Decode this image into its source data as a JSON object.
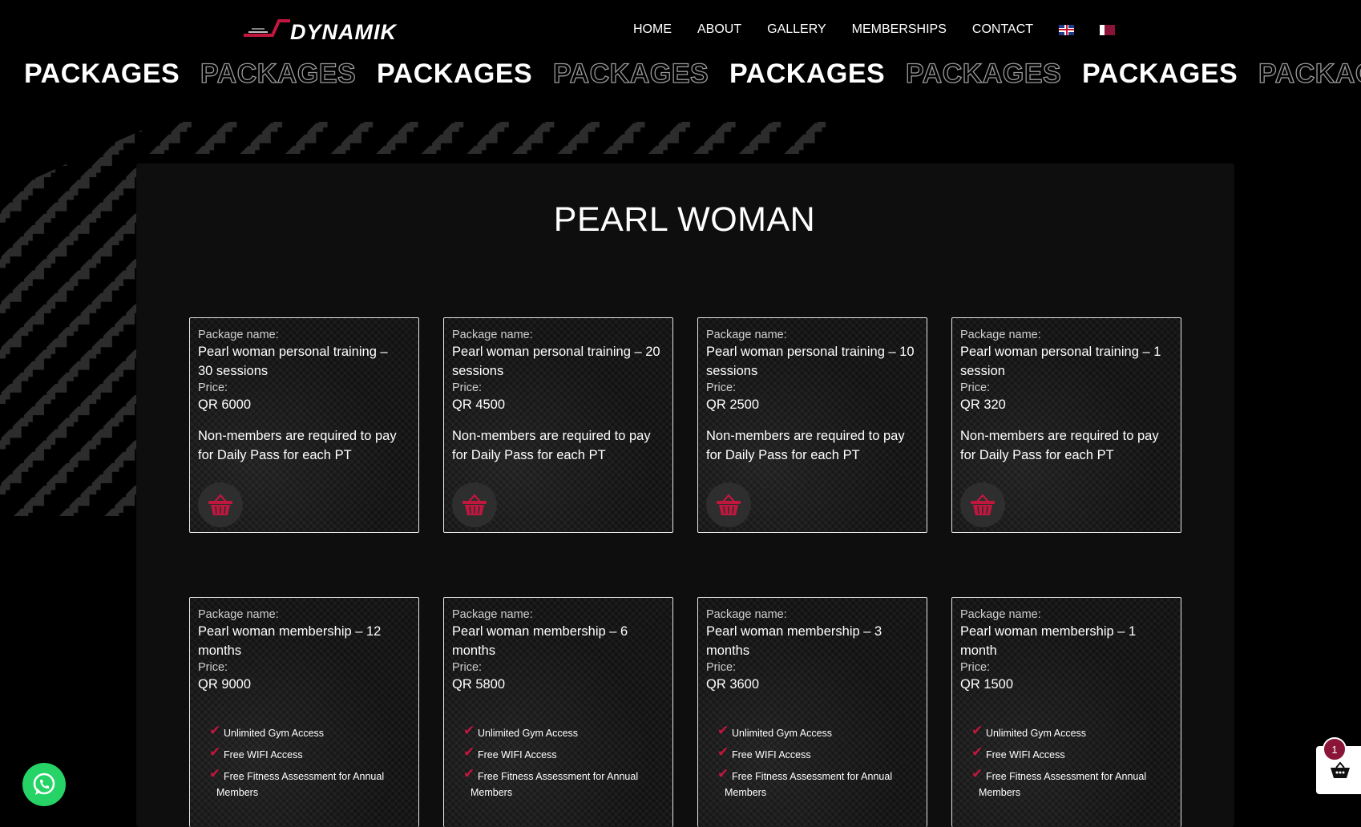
{
  "header": {
    "logo_text": "DYNAMIK",
    "nav": [
      {
        "label": "HOME"
      },
      {
        "label": "ABOUT"
      },
      {
        "label": "GALLERY"
      },
      {
        "label": "MEMBERSHIPS"
      },
      {
        "label": "CONTACT"
      }
    ],
    "flags": [
      "uk-flag-icon",
      "qatar-flag-icon"
    ]
  },
  "marquee": {
    "words": [
      "PACKAGES",
      "PACKAGES",
      "PACKAGES",
      "PACKAGES",
      "PACKAGES",
      "PACKAGES",
      "PACKAGES",
      "PACKAGES"
    ]
  },
  "section": {
    "title": "PEARL WOMAN"
  },
  "labels": {
    "package_name": "Package name:",
    "price": "Price:"
  },
  "pt_packages": [
    {
      "name_line1": "Pearl woman personal training –",
      "name_line2": "30 sessions",
      "price": "QR 6000",
      "note_line1": "Non-members are required to pay",
      "note_line2": "for Daily Pass for each PT"
    },
    {
      "name_line1": "Pearl woman personal training – 20",
      "name_line2": "sessions",
      "price": "QR 4500",
      "note_line1": "Non-members are required to pay",
      "note_line2": "for Daily Pass for each PT"
    },
    {
      "name_line1": "Pearl woman personal training – 10",
      "name_line2": "sessions",
      "price": "QR 2500",
      "note_line1": "Non-members are required to pay",
      "note_line2": "for Daily Pass for each PT"
    },
    {
      "name_line1": "Pearl woman personal training – 1",
      "name_line2": "session",
      "price": "QR 320",
      "note_line1": "Non-members are required to pay",
      "note_line2": "for Daily Pass for each PT"
    }
  ],
  "memberships": [
    {
      "name_line1": "Pearl woman membership – 12",
      "name_line2": "months",
      "price": "QR 9000"
    },
    {
      "name_line1": "Pearl woman membership – 6",
      "name_line2": "months",
      "price": "QR 5800"
    },
    {
      "name_line1": "Pearl woman membership – 3",
      "name_line2": "months",
      "price": "QR 3600"
    },
    {
      "name_line1": "Pearl woman membership – 1",
      "name_line2": "month",
      "price": "QR 1500"
    }
  ],
  "features": {
    "f1": "Unlimited Gym Access",
    "f2": "Free WIFI Access",
    "f3_line1": "Free Fitness Assessment for Annual",
    "f3_line2": "Members"
  },
  "cart": {
    "count": "1"
  },
  "colors": {
    "accent": "#c0173f",
    "panel": "#0e0e0e",
    "whatsapp": "#25d366"
  }
}
